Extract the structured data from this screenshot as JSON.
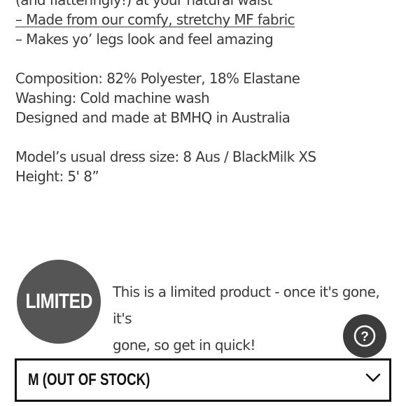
{
  "description": {
    "line_waist": "(and flatteringly!) at your natural waist",
    "line_fabric": "– Made from our comfy, stretchy MF fabric",
    "line_legs": "– Makes yo’ legs look and feel amazing",
    "composition": "Composition: 82% Polyester, 18% Elastane",
    "washing": "Washing: Cold machine wash",
    "origin": "Designed and made at BMHQ in Australia",
    "model_size": "Model’s usual dress size: 8 Aus / BlackMilk XS",
    "height": "Height: 5' 8”"
  },
  "limited": {
    "badge_label": "LIMITED",
    "line1": "This is a limited product - once it's gone, it's",
    "line2": "gone, so get in quick!"
  },
  "help": {
    "icon": "question-circle-icon",
    "glyph": "?"
  },
  "size_select": {
    "selected_value": "M (OUT OF STOCK)",
    "icon": "chevron-down-icon"
  },
  "colors": {
    "text": "#3a3a3a",
    "badge_bg": "#555555",
    "help_bg": "#3c3c3c",
    "select_border": "#111111"
  }
}
